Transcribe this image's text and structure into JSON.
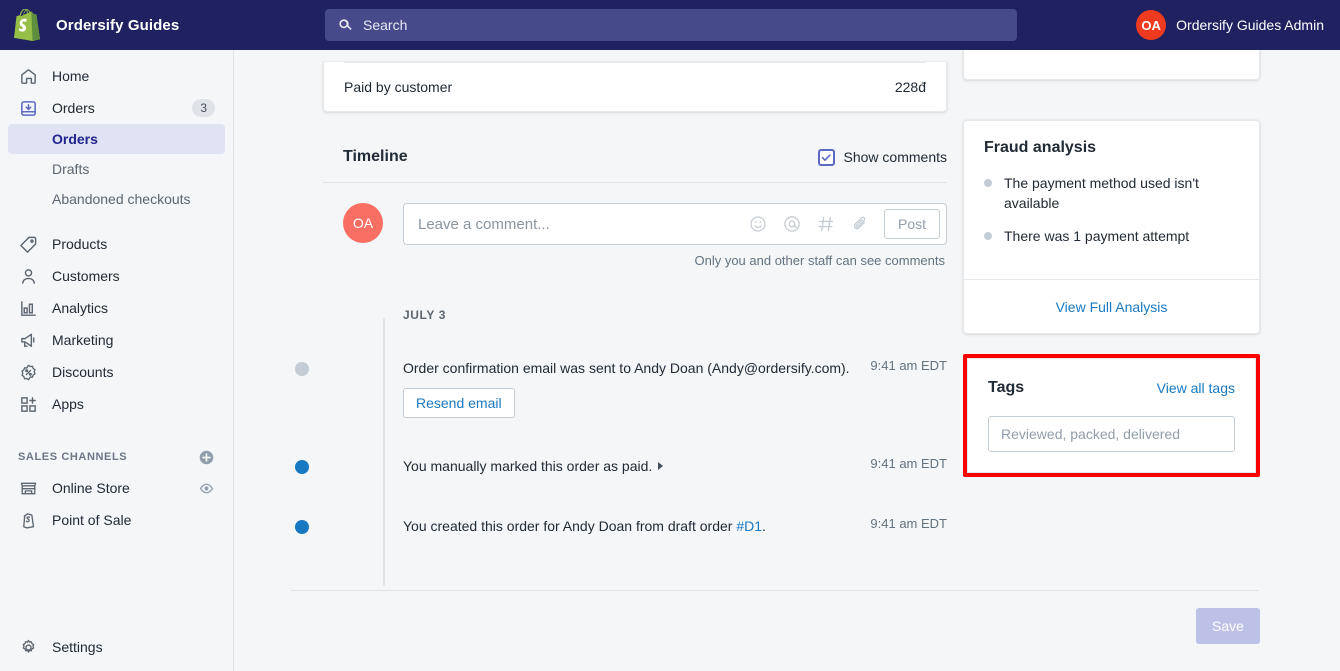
{
  "topbar": {
    "brand_name": "Ordersify Guides",
    "logo_icon": "shopify-bag-icon",
    "search": {
      "icon": "search-icon",
      "placeholder": "Search",
      "value": ""
    },
    "user": {
      "initials": "OA",
      "name": "Ordersify Guides Admin",
      "avatar_color": "#ee3b1f"
    }
  },
  "sidebar": {
    "items": [
      {
        "label": "Home",
        "icon": "home-icon"
      },
      {
        "label": "Orders",
        "icon": "orders-inbox-icon",
        "badge": "3",
        "active_parent": true
      },
      {
        "label": "Products",
        "icon": "tag-icon"
      },
      {
        "label": "Customers",
        "icon": "person-icon"
      },
      {
        "label": "Analytics",
        "icon": "bar-chart-icon"
      },
      {
        "label": "Marketing",
        "icon": "megaphone-icon"
      },
      {
        "label": "Discounts",
        "icon": "percent-badge-icon"
      },
      {
        "label": "Apps",
        "icon": "apps-grid-plus-icon"
      }
    ],
    "orders_subitems": [
      {
        "label": "Orders",
        "active": true
      },
      {
        "label": "Drafts",
        "active": false
      },
      {
        "label": "Abandoned checkouts",
        "active": false
      }
    ],
    "sales_channels": {
      "title": "SALES CHANNELS",
      "add_icon": "plus-circle-icon",
      "items": [
        {
          "label": "Online Store",
          "icon": "storefront-icon",
          "trailing_icon": "eye-icon"
        },
        {
          "label": "Point of Sale",
          "icon": "pos-bag-icon"
        }
      ]
    },
    "settings": {
      "label": "Settings",
      "icon": "gear-icon"
    }
  },
  "order_totals": {
    "row_label": "Paid by customer",
    "row_value": "228đ"
  },
  "timeline": {
    "title": "Timeline",
    "show_comments_label": "Show comments",
    "show_comments_checked": true,
    "checkbox_icon": "checkmark-icon",
    "composer": {
      "avatar_initials": "OA",
      "avatar_color": "#f96f63",
      "placeholder": "Leave a comment...",
      "value": "",
      "icons": [
        "emoji-smiley-icon",
        "mention-at-icon",
        "hashtag-icon",
        "paperclip-icon"
      ],
      "post_label": "Post",
      "note": "Only you and other staff can see comments"
    },
    "date_group": "JULY 3",
    "entries": [
      {
        "dot": "grey",
        "text": "Order confirmation email was sent to Andy Doan (Andy@ordersify.com).",
        "time": "9:41 am EDT",
        "action_label": "Resend email",
        "has_caret": false,
        "link": null
      },
      {
        "dot": "blue",
        "text": "You manually marked this order as paid.",
        "time": "9:41 am EDT",
        "action_label": null,
        "has_caret": true,
        "caret_icon": "caret-right-icon",
        "link": null
      },
      {
        "dot": "blue",
        "text_before": "You created this order for Andy Doan from draft order ",
        "link": "#D1",
        "text_after": ".",
        "time": "9:41 am EDT",
        "action_label": null,
        "has_caret": false
      }
    ]
  },
  "fraud_analysis": {
    "title": "Fraud analysis",
    "items": [
      "The payment method used isn't available",
      "There was 1 payment attempt"
    ],
    "footer_link": "View Full Analysis"
  },
  "tags": {
    "title": "Tags",
    "view_all_link": "View all tags",
    "input_placeholder": "Reviewed, packed, delivered",
    "input_value": "",
    "highlight_color": "#ff0000"
  },
  "footer": {
    "save_label": "Save",
    "save_disabled": true
  }
}
